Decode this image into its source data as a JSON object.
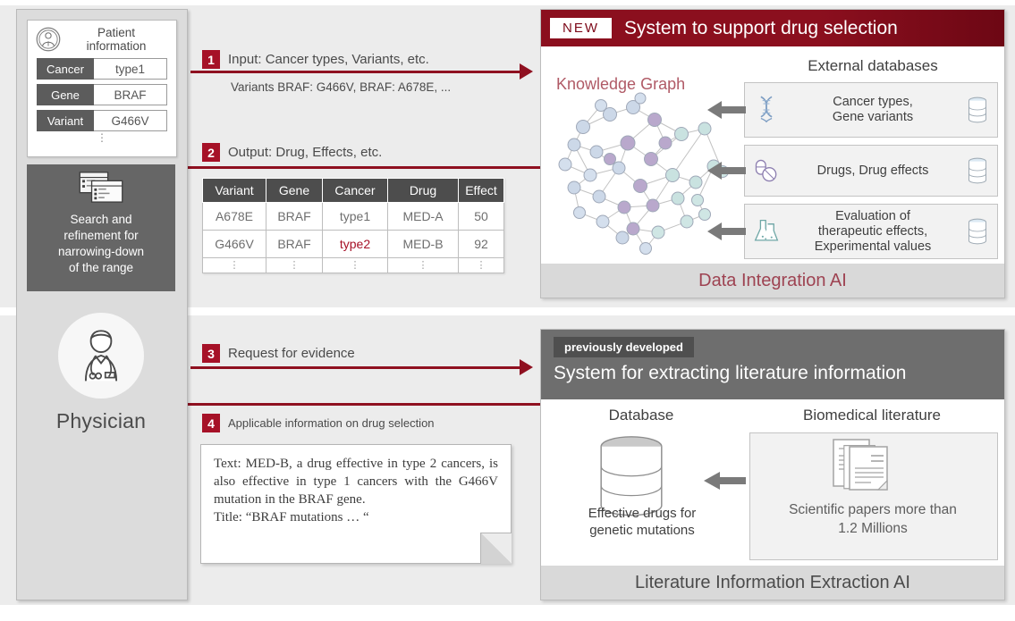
{
  "left_column": {
    "patient_card": {
      "title": "Patient\ninformation",
      "title_line1": "Patient",
      "title_line2": "information",
      "icon": "patient-avatar-icon",
      "rows": [
        {
          "key": "Cancer",
          "value": "type1"
        },
        {
          "key": "Gene",
          "value": "BRAF"
        },
        {
          "key": "Variant",
          "value": "G466V"
        }
      ],
      "more": "⋮"
    },
    "search_box": {
      "icon": "windows-search-icon",
      "caption_line1": "Search and",
      "caption_line2": "refinement for",
      "caption_line3": "narrowing-down",
      "caption_line4": "of the range",
      "caption": "Search and refinement for narrowing-down of the range"
    },
    "physician": {
      "icon": "physician-avatar-icon",
      "label": "Physician"
    }
  },
  "steps": [
    {
      "num": "1",
      "label": "Input: Cancer types, Variants, etc.",
      "sub": "Variants BRAF: G466V, BRAF: A678E, ..."
    },
    {
      "num": "2",
      "label": "Output: Drug, Effects, etc."
    },
    {
      "num": "3",
      "label": "Request for evidence"
    },
    {
      "num": "4",
      "label": "Applicable information on drug selection"
    }
  ],
  "result_table": {
    "headers": [
      "Variant",
      "Gene",
      "Cancer",
      "Drug",
      "Effect"
    ],
    "rows": [
      {
        "cells": [
          "A678E",
          "BRAF",
          "type1",
          "MED-A",
          "50"
        ],
        "highlight_index": -1
      },
      {
        "cells": [
          "G466V",
          "BRAF",
          "type2",
          "MED-B",
          "92"
        ],
        "highlight_index": 2
      }
    ],
    "ellipsis": "⋮"
  },
  "note": {
    "body": "Text: MED-B, a drug effective in type 2 cancers, is also effective in type 1 cancers with the G466V mutation in the BRAF gene.",
    "title_line": "Title: “BRAF mutations … “"
  },
  "panel_top": {
    "badge": "NEW",
    "title": "System to support drug selection",
    "knowledge_graph_label": "Knowledge Graph",
    "external_title": "External databases",
    "external_items": [
      {
        "icon": "dna-helix-icon",
        "label": "Cancer types,\nGene variants",
        "line1": "Cancer types,",
        "line2": "Gene variants",
        "line3": "",
        "db_icon": "database-cylinder-icon"
      },
      {
        "icon": "pills-capsule-icon",
        "label": "Drugs, Drug effects",
        "line1": "Drugs, Drug effects",
        "line2": "",
        "line3": "",
        "db_icon": "database-cylinder-icon"
      },
      {
        "icon": "flasks-icon",
        "label": "Evaluation of therapeutic effects, Experimental values",
        "line1": "Evaluation of",
        "line2": "therapeutic effects,",
        "line3": "Experimental values",
        "db_icon": "database-cylinder-icon"
      }
    ],
    "footer": "Data Integration AI"
  },
  "panel_bottom": {
    "badge": "previously developed",
    "title": "System for extracting literature information",
    "database_caption": "Database",
    "database_text_line1": "Effective drugs for",
    "database_text_line2": "genetic mutations",
    "literature_caption": "Biomedical literature",
    "literature_text_line1": "Scientific papers more than",
    "literature_text_line2": "1.2 Millions",
    "footer": "Literature Information Extraction AI"
  },
  "colors": {
    "accent_red": "#a61127",
    "header_red": "#8b0f1e",
    "dark_gray": "#6e6e6e",
    "panel_gray": "#d9d9d9",
    "background": "#ececec"
  }
}
